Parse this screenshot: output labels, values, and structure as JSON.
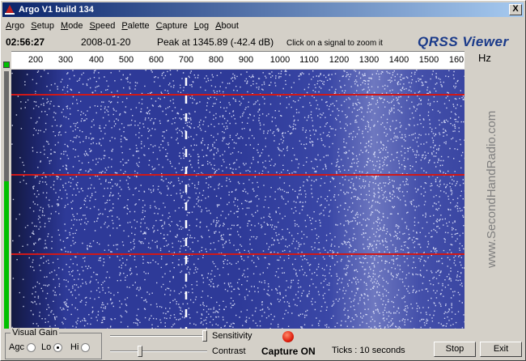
{
  "window": {
    "title": "Argo V1 build 134",
    "close_label": "X"
  },
  "menu": [
    "Argo",
    "Setup",
    "Mode",
    "Speed",
    "Palette",
    "Capture",
    "Log",
    "About"
  ],
  "info": {
    "time": "02:56:27",
    "date": "2008-01-20",
    "peak": "Peak at 1345.89 (-42.4 dB)",
    "hint": "Click on a signal to zoom it",
    "brand": "QRSS Viewer"
  },
  "scale": {
    "ticks": [
      "200",
      "300",
      "400",
      "500",
      "600",
      "700",
      "800",
      "900",
      "1000",
      "1100",
      "1200",
      "1300",
      "1400",
      "1500",
      "160"
    ],
    "unit": "Hz"
  },
  "watermark": "www.SecondHandRadio.com",
  "visual_gain": {
    "legend": "Visual Gain",
    "options": [
      "Agc",
      "Lo",
      "Hi"
    ],
    "selected": "Lo"
  },
  "sliders": {
    "sensitivity_label": "Sensitivity",
    "contrast_label": "Contrast",
    "sensitivity_level": 1.0,
    "contrast_level": 0.3
  },
  "capture": {
    "label": "Capture ON"
  },
  "ticks": {
    "text": "Ticks   : 10 seconds"
  },
  "buttons": {
    "stop": "Stop",
    "exit": "Exit"
  },
  "colors": {
    "waterfall_bg": "#2a3590",
    "marker_line": "#d01818",
    "title_bar": "#0a246a"
  }
}
